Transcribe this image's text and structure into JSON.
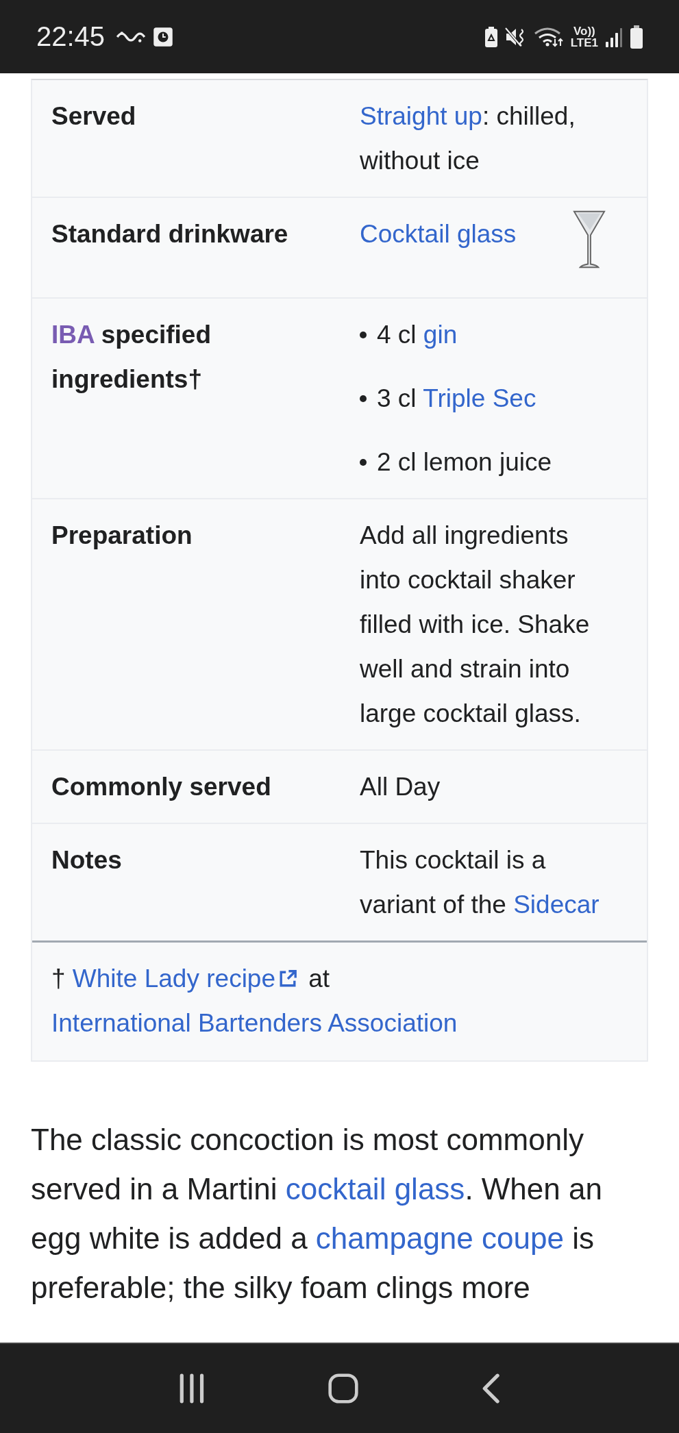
{
  "status_bar": {
    "time": "22:45",
    "volte": "Vo))",
    "network": "LTE1"
  },
  "infobox": {
    "rows": [
      {
        "label": [
          {
            "kind": "text",
            "text": "Served"
          }
        ],
        "value": {
          "kind": "text",
          "parts": [
            {
              "kind": "link",
              "text": "Straight up"
            },
            {
              "kind": "text",
              "text": ": chilled, without ice"
            }
          ]
        }
      },
      {
        "label": [
          {
            "kind": "text",
            "text": "Standard drinkware"
          }
        ],
        "value": {
          "kind": "glass",
          "parts": [
            {
              "kind": "link",
              "text": "Cocktail glass"
            }
          ]
        }
      },
      {
        "label": [
          {
            "kind": "visited",
            "text": "IBA"
          },
          {
            "kind": "text",
            "text": " specified ingredients†"
          }
        ],
        "value": {
          "kind": "list",
          "items": [
            [
              {
                "kind": "text",
                "text": "4 cl "
              },
              {
                "kind": "link",
                "text": "gin"
              }
            ],
            [
              {
                "kind": "text",
                "text": "3 cl "
              },
              {
                "kind": "link",
                "text": "Triple Sec"
              }
            ],
            [
              {
                "kind": "text",
                "text": "2 cl lemon juice"
              }
            ]
          ]
        }
      },
      {
        "label": [
          {
            "kind": "text",
            "text": "Preparation"
          }
        ],
        "value": {
          "kind": "text",
          "parts": [
            {
              "kind": "text",
              "text": "Add all ingredients into cocktail shaker filled with ice. Shake well and strain into large cocktail glass."
            }
          ]
        }
      },
      {
        "label": [
          {
            "kind": "text",
            "text": "Commonly served"
          }
        ],
        "value": {
          "kind": "text",
          "parts": [
            {
              "kind": "text",
              "text": "All Day"
            }
          ]
        }
      },
      {
        "label": [
          {
            "kind": "text",
            "text": "Notes"
          }
        ],
        "value": {
          "kind": "text",
          "parts": [
            {
              "kind": "text",
              "text": "This cocktail is a variant of the "
            },
            {
              "kind": "link",
              "text": "Sidecar"
            }
          ]
        }
      }
    ],
    "footnote": [
      {
        "kind": "text",
        "text": "† "
      },
      {
        "kind": "external",
        "text": "White Lady recipe"
      },
      {
        "kind": "text",
        "text": " at "
      },
      {
        "kind": "link",
        "text": "International Bartenders Association"
      }
    ]
  },
  "paragraph": [
    {
      "kind": "text",
      "text": "The classic concoction is most commonly served in a Martini "
    },
    {
      "kind": "link",
      "text": "cocktail glass"
    },
    {
      "kind": "text",
      "text": ". When an egg white is added a "
    },
    {
      "kind": "link",
      "text": "champagne coupe"
    },
    {
      "kind": "text",
      "text": " is preferable; the silky foam clings more"
    }
  ]
}
